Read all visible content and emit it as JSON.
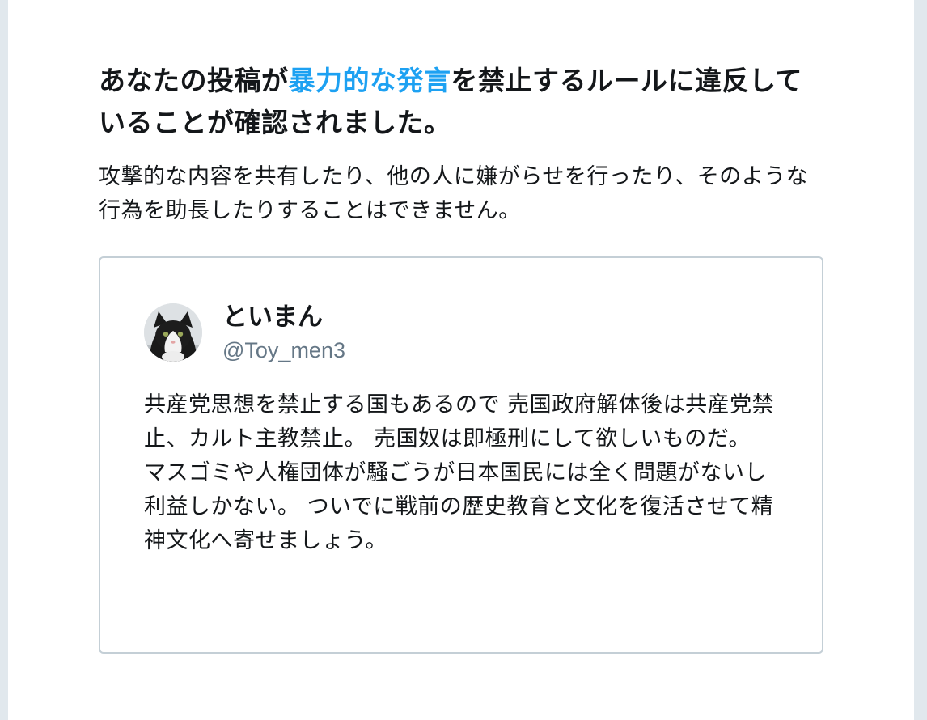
{
  "notice": {
    "heading_part1": "あなたの投稿が",
    "heading_highlight": "暴力的な発言",
    "heading_part2": "を禁止するルールに違反していることが確認されました。",
    "description": "攻撃的な内容を共有したり、他の人に嫌がらせを行ったり、そのような行為を助長したりすることはできません。",
    "highlight_color": "#1da1f2"
  },
  "tweet": {
    "display_name": "といまん",
    "handle": "@Toy_men3",
    "text": "共産党思想を禁止する国もあるので 売国政府解体後は共産党禁止、カルト主教禁止。 売国奴は即極刑にして欲しいものだ。 マスゴミや人権団体が騒ごうが日本国民には全く問題がないし利益しかない。 ついでに戦前の歴史教育と文化を復活させて精神文化へ寄せましょう。",
    "avatar_icon": "cat-avatar-icon"
  }
}
